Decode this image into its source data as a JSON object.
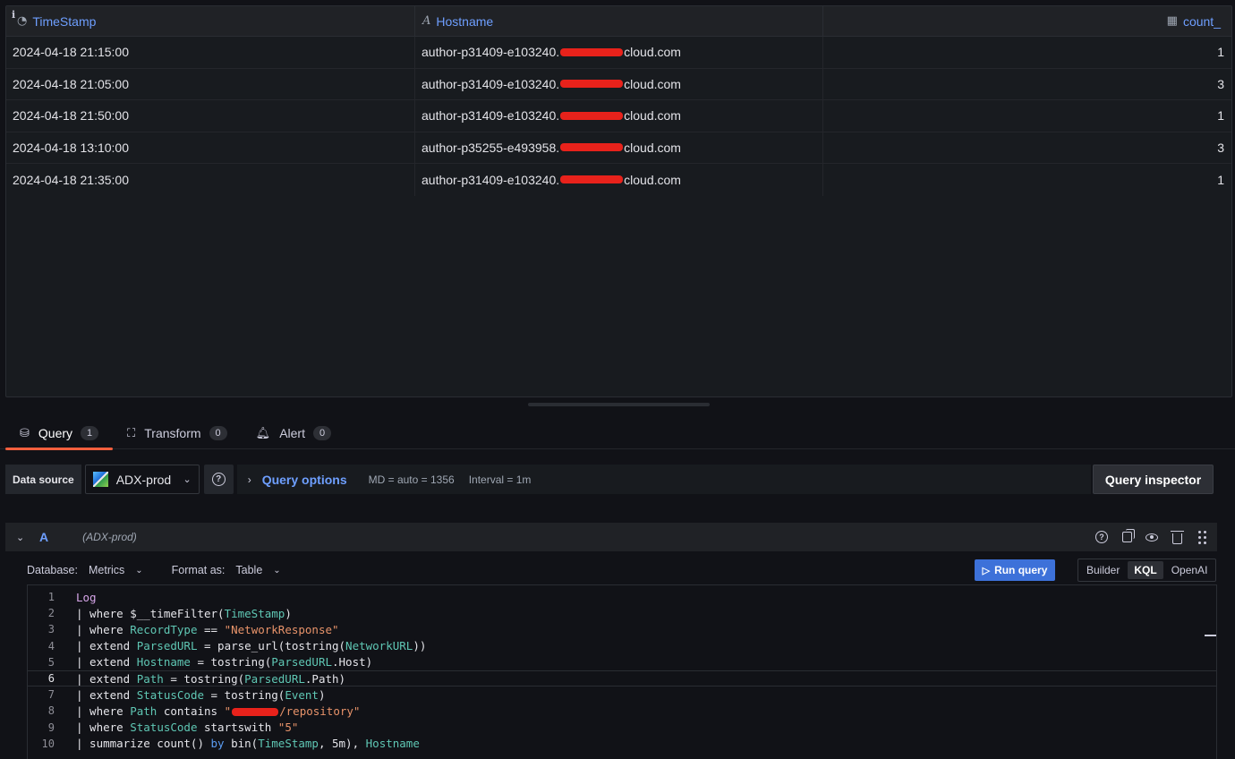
{
  "table": {
    "info_glyph": "i",
    "columns": [
      {
        "label": "TimeStamp",
        "icon": "clock-icon"
      },
      {
        "label": "Hostname",
        "icon": "text-type-icon"
      },
      {
        "label": "count_",
        "icon": "numeric-table-icon"
      }
    ],
    "rows": [
      {
        "timestamp": "2024-04-18 21:15:00",
        "host_prefix": "author-p31409-e103240.",
        "host_suffix": "cloud.com",
        "count": "1"
      },
      {
        "timestamp": "2024-04-18 21:05:00",
        "host_prefix": "author-p31409-e103240.",
        "host_suffix": "cloud.com",
        "count": "3"
      },
      {
        "timestamp": "2024-04-18 21:50:00",
        "host_prefix": "author-p31409-e103240.",
        "host_suffix": "cloud.com",
        "count": "1"
      },
      {
        "timestamp": "2024-04-18 13:10:00",
        "host_prefix": "author-p35255-e493958.",
        "host_suffix": "cloud.com",
        "count": "3"
      },
      {
        "timestamp": "2024-04-18 21:35:00",
        "host_prefix": "author-p31409-e103240.",
        "host_suffix": "cloud.com",
        "count": "1"
      }
    ]
  },
  "tabs": [
    {
      "label": "Query",
      "count": "1",
      "icon": "database-icon"
    },
    {
      "label": "Transform",
      "count": "0",
      "icon": "transform-icon"
    },
    {
      "label": "Alert",
      "count": "0",
      "icon": "bell-icon"
    }
  ],
  "datasource_bar": {
    "label": "Data source",
    "selected": "ADX-prod",
    "query_options_label": "Query options",
    "md_text": "MD = auto = 1356",
    "interval_text": "Interval = 1m",
    "inspector_label": "Query inspector"
  },
  "query": {
    "ref_id": "A",
    "datasource_hint": "(ADX-prod)",
    "database_label": "Database:",
    "database_value": "Metrics",
    "format_label": "Format as:",
    "format_value": "Table",
    "run_label": "Run query",
    "modes": [
      "Builder",
      "KQL",
      "OpenAI"
    ],
    "active_mode": "KQL"
  },
  "code": {
    "line_numbers": [
      "1",
      "2",
      "3",
      "4",
      "5",
      "6",
      "7",
      "8",
      "9",
      "10"
    ],
    "l1": "Log",
    "l2": [
      "| where $__timeFilter(",
      "TimeStamp",
      ")"
    ],
    "l3": [
      "| where ",
      "RecordType",
      " == ",
      "\"NetworkResponse\""
    ],
    "l4": [
      "| extend ",
      "ParsedURL",
      " = parse_url(tostring(",
      "NetworkURL",
      "))"
    ],
    "l5": [
      "| extend ",
      "Hostname",
      " = tostring(",
      "ParsedURL",
      ".Host)"
    ],
    "l6": [
      "| extend ",
      "Path",
      " = tostring(",
      "ParsedURL",
      ".Path)"
    ],
    "l7": [
      "| extend ",
      "StatusCode",
      " = tostring(",
      "Event",
      ")"
    ],
    "l8": [
      "| where ",
      "Path",
      " contains ",
      "\"",
      "/repository\""
    ],
    "l9": [
      "| where ",
      "StatusCode",
      " startswith ",
      "\"5\""
    ],
    "l10": [
      "| summarize count() ",
      "by",
      " bin(",
      "TimeStamp",
      ", 5m), ",
      "Hostname"
    ]
  },
  "colors": {
    "accent_tab": "#f55f3e",
    "link_blue": "#6e9fff",
    "run_button": "#3d71d9",
    "redaction": "#e8221b"
  }
}
